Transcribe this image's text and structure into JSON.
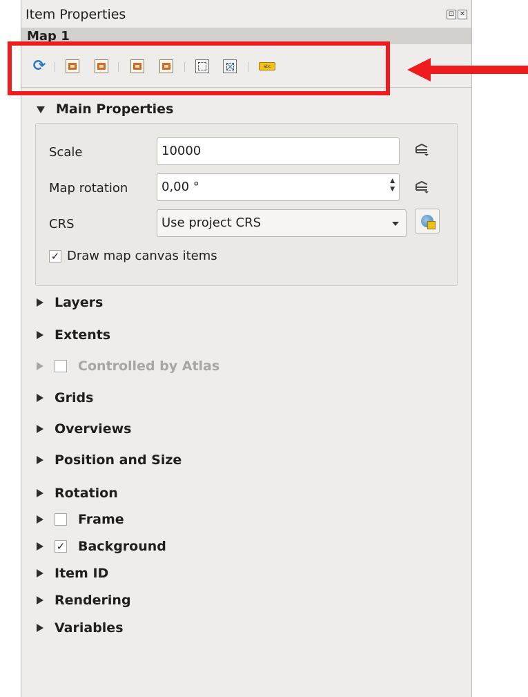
{
  "panel": {
    "title": "Item Properties",
    "float_btn": "⊡",
    "close_btn": "✕",
    "item_name": "Map 1"
  },
  "toolbar": {
    "buttons": [
      {
        "name": "update-preview",
        "icon": "refresh-icon"
      },
      {
        "name": "set-extent-from-canvas",
        "icon": "map-extent-icon"
      },
      {
        "name": "set-canvas-to-extent",
        "icon": "view-extent-icon"
      },
      {
        "name": "set-scale-from-canvas",
        "icon": "map-scale-icon"
      },
      {
        "name": "set-canvas-to-scale",
        "icon": "view-scale-icon"
      },
      {
        "name": "bookmarks",
        "icon": "bookmark-icon"
      },
      {
        "name": "interactive-extent",
        "icon": "move-content-icon"
      },
      {
        "name": "label-settings",
        "icon": "label-icon",
        "text": "abc"
      }
    ]
  },
  "annotation": {
    "highlight_color": "#ee1c1c",
    "arrow_color": "#ee1c1c"
  },
  "main_properties": {
    "title": "Main Properties",
    "scale_label": "Scale",
    "scale_value": "10000",
    "rotation_label": "Map rotation",
    "rotation_value": "0,00 °",
    "crs_label": "CRS",
    "crs_value": "Use project CRS",
    "draw_items_label": "Draw map canvas items",
    "draw_items_checked": true
  },
  "sections": {
    "layers": "Layers",
    "extents": "Extents",
    "atlas": "Controlled by Atlas",
    "grids": "Grids",
    "overviews": "Overviews",
    "position": "Position and Size",
    "rotation": "Rotation",
    "frame": "Frame",
    "background": "Background",
    "item_id": "Item ID",
    "rendering": "Rendering",
    "variables": "Variables"
  },
  "checkmark": "✓"
}
